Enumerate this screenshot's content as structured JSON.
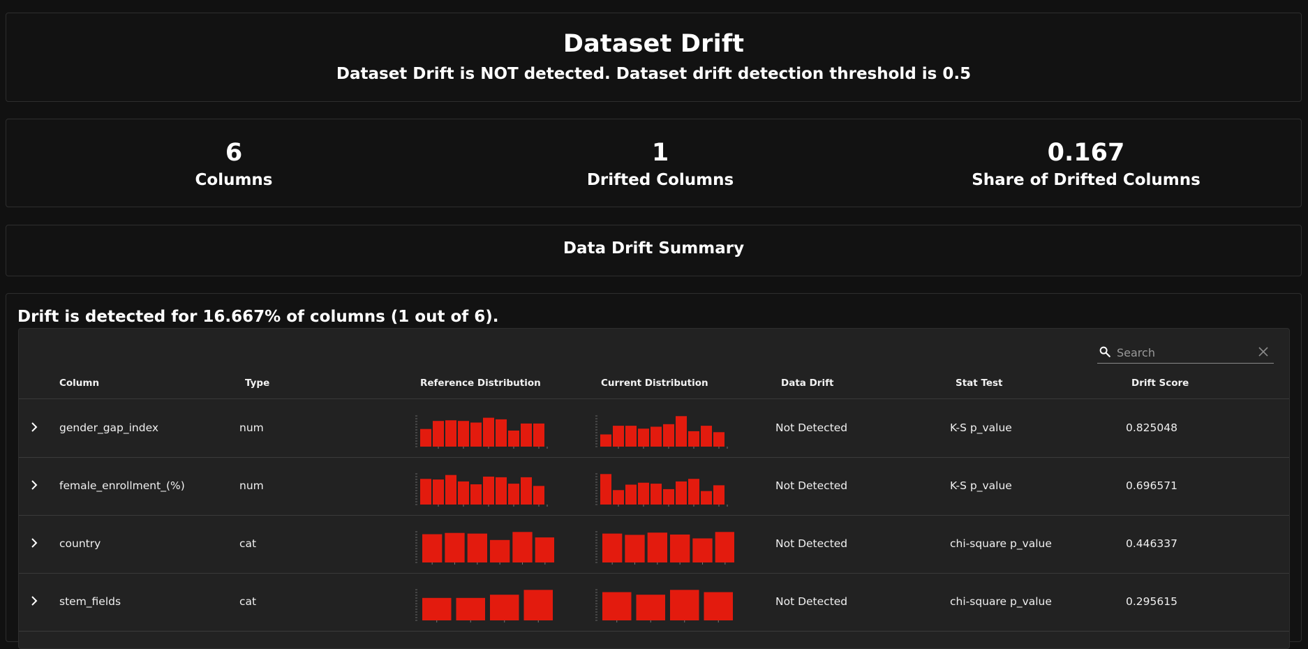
{
  "header": {
    "title": "Dataset Drift",
    "subtitle": "Dataset Drift is NOT detected. Dataset drift detection threshold is 0.5"
  },
  "counters": [
    {
      "value": "6",
      "label": "Columns"
    },
    {
      "value": "1",
      "label": "Drifted Columns"
    },
    {
      "value": "0.167",
      "label": "Share of Drifted Columns"
    }
  ],
  "summary": {
    "title": "Data Drift Summary"
  },
  "table": {
    "description": "Drift is detected for 16.667% of columns (1 out of 6).",
    "search_placeholder": "Search",
    "columns": [
      "Column",
      "Type",
      "Reference Distribution",
      "Current Distribution",
      "Data Drift",
      "Stat Test",
      "Drift Score"
    ],
    "bar_color": "#e31b0e",
    "rows": [
      {
        "column": "gender_gap_index",
        "type": "num",
        "reference": [
          0.55,
          0.8,
          0.82,
          0.8,
          0.75,
          0.9,
          0.85,
          0.5,
          0.72,
          0.72
        ],
        "current": [
          0.38,
          0.65,
          0.65,
          0.56,
          0.62,
          0.7,
          0.95,
          0.48,
          0.65,
          0.45
        ],
        "data_drift": "Not Detected",
        "stat_test": "K-S p_value",
        "drift_score": "0.825048"
      },
      {
        "column": "female_enrollment_(%)",
        "type": "num",
        "reference": [
          0.8,
          0.78,
          0.92,
          0.72,
          0.63,
          0.87,
          0.85,
          0.65,
          0.85,
          0.58
        ],
        "current": [
          0.95,
          0.45,
          0.62,
          0.68,
          0.65,
          0.48,
          0.72,
          0.8,
          0.42,
          0.6
        ],
        "data_drift": "Not Detected",
        "stat_test": "K-S p_value",
        "drift_score": "0.696571"
      },
      {
        "column": "country",
        "type": "cat",
        "reference": [
          0.88,
          0.92,
          0.9,
          0.7,
          0.95,
          0.78
        ],
        "current": [
          0.9,
          0.86,
          0.93,
          0.87,
          0.75,
          0.95
        ],
        "data_drift": "Not Detected",
        "stat_test": "chi-square p_value",
        "drift_score": "0.446337"
      },
      {
        "column": "stem_fields",
        "type": "cat",
        "reference": [
          0.7,
          0.7,
          0.8,
          0.95
        ],
        "current": [
          0.88,
          0.8,
          0.95,
          0.88
        ],
        "data_drift": "Not Detected",
        "stat_test": "chi-square p_value",
        "drift_score": "0.295615"
      }
    ]
  }
}
